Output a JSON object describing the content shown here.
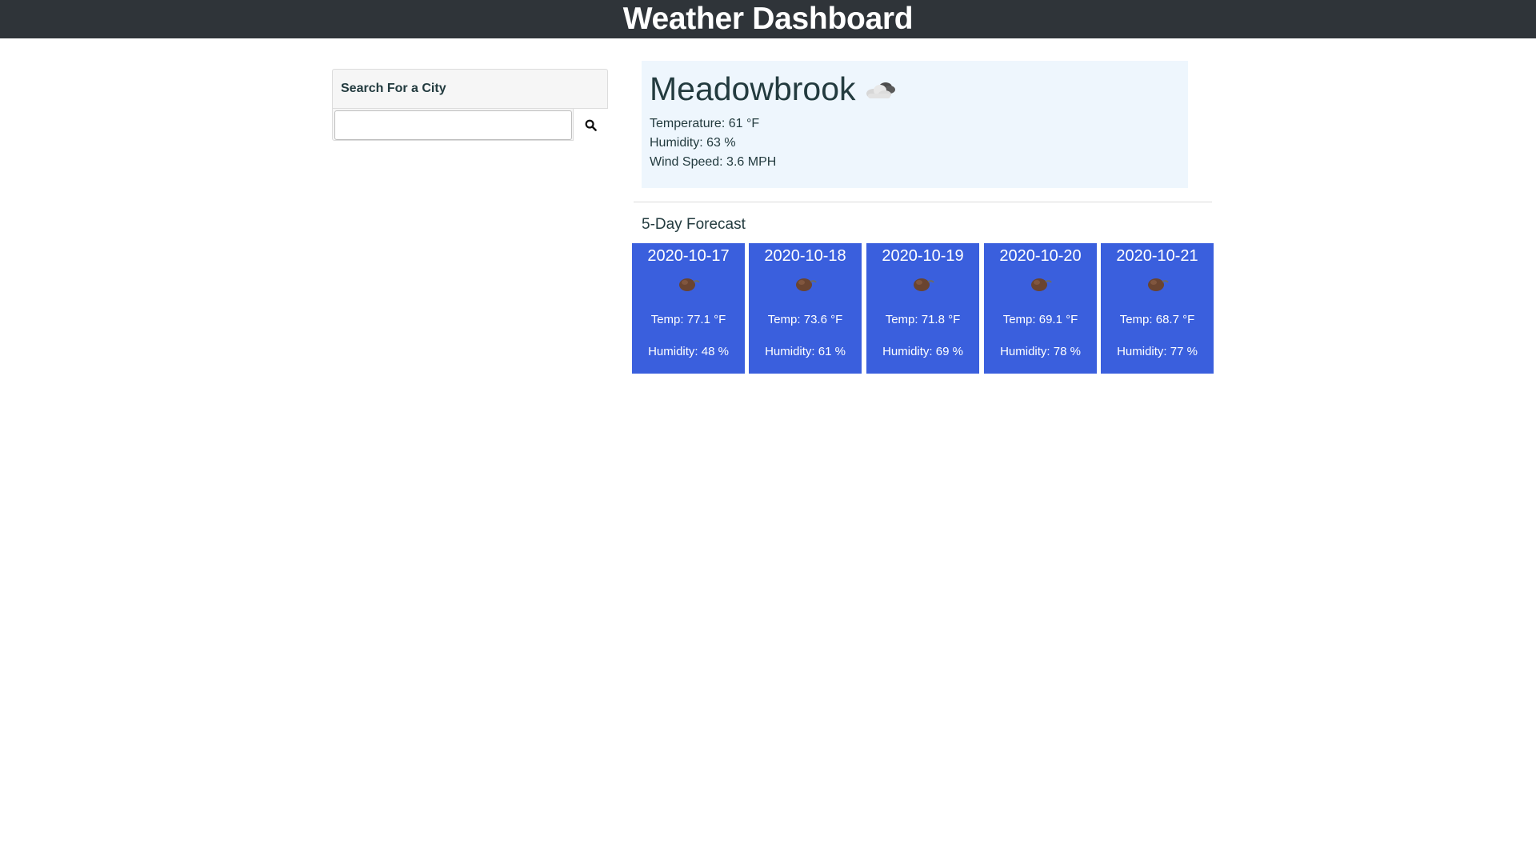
{
  "header": {
    "title": "Weather Dashboard"
  },
  "search": {
    "title": "Search For a City",
    "value": "",
    "placeholder": "",
    "button_icon": "search-icon"
  },
  "current": {
    "city": "Meadowbrook",
    "icon": "partly-cloudy-icon",
    "temperature": "Temperature: 61 °F",
    "humidity": "Humidity: 63 %",
    "wind": "Wind Speed: 3.6 MPH"
  },
  "forecast": {
    "title": "5-Day Forecast",
    "accent_color": "#3a5fdd",
    "days": [
      {
        "date": "2020-10-17",
        "icon": "weather-icon",
        "temp": "Temp: 77.1 °F",
        "humidity": "Humidity: 48 %"
      },
      {
        "date": "2020-10-18",
        "icon": "weather-icon",
        "temp": "Temp: 73.6 °F",
        "humidity": "Humidity: 61 %"
      },
      {
        "date": "2020-10-19",
        "icon": "weather-icon",
        "temp": "Temp: 71.8 °F",
        "humidity": "Humidity: 69 %"
      },
      {
        "date": "2020-10-20",
        "icon": "weather-icon",
        "temp": "Temp: 69.1 °F",
        "humidity": "Humidity: 78 %"
      },
      {
        "date": "2020-10-21",
        "icon": "weather-icon",
        "temp": "Temp: 68.7 °F",
        "humidity": "Humidity: 77 %"
      }
    ]
  }
}
